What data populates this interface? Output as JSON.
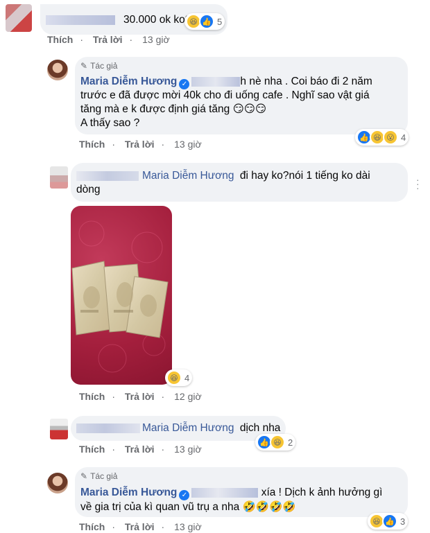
{
  "comments": [
    {
      "text": "30.000 ok ko?",
      "reaction_count": "5",
      "actions": {
        "like": "Thích",
        "reply": "Trả lời",
        "time": "13 giờ"
      }
    },
    {
      "author_badge": "Tác giả",
      "author": "Maria Diễm Hương",
      "text_tail": "h nè nha . Coi báo đi 2 năm",
      "text_lines": [
        "trước e đã được mời 40k cho đi uống cafe . Nghĩ sao vật giá",
        "tăng mà e k được định giá tăng 😏😏😏",
        "A thấy sao ?"
      ],
      "reaction_count": "4",
      "actions": {
        "like": "Thích",
        "reply": "Trả lời",
        "time": "13 giờ"
      }
    },
    {
      "mention": "Maria Diễm Hương",
      "text_line1": "đi hay ko?nói 1 tiếng ko dài",
      "text_line2": "dòng",
      "image_reaction_count": "4",
      "actions": {
        "like": "Thích",
        "reply": "Trả lời",
        "time": "12 giờ"
      }
    },
    {
      "mention": "Maria Diễm Hương",
      "text": "dịch nha",
      "reaction_count": "2",
      "actions": {
        "like": "Thích",
        "reply": "Trả lời",
        "time": "13 giờ"
      }
    },
    {
      "author_badge": "Tác giả",
      "author": "Maria Diễm Hương",
      "text_tail": "xía ! Dịch k ảnh hưởng gì",
      "text_line2": "về gia trị của kì quan vũ trụ a nha 🤣🤣🤣🤣",
      "reaction_count": "3",
      "actions": {
        "like": "Thích",
        "reply": "Trả lời",
        "time": "13 giờ"
      }
    }
  ],
  "colors": {
    "bubble": "#f0f2f5",
    "name": "#385898",
    "meta": "#65676b",
    "like_blue": "#1877f2"
  },
  "icons": [
    "haha-icon",
    "like-icon",
    "wow-icon",
    "verified-icon",
    "pen-icon",
    "more-options-icon"
  ]
}
